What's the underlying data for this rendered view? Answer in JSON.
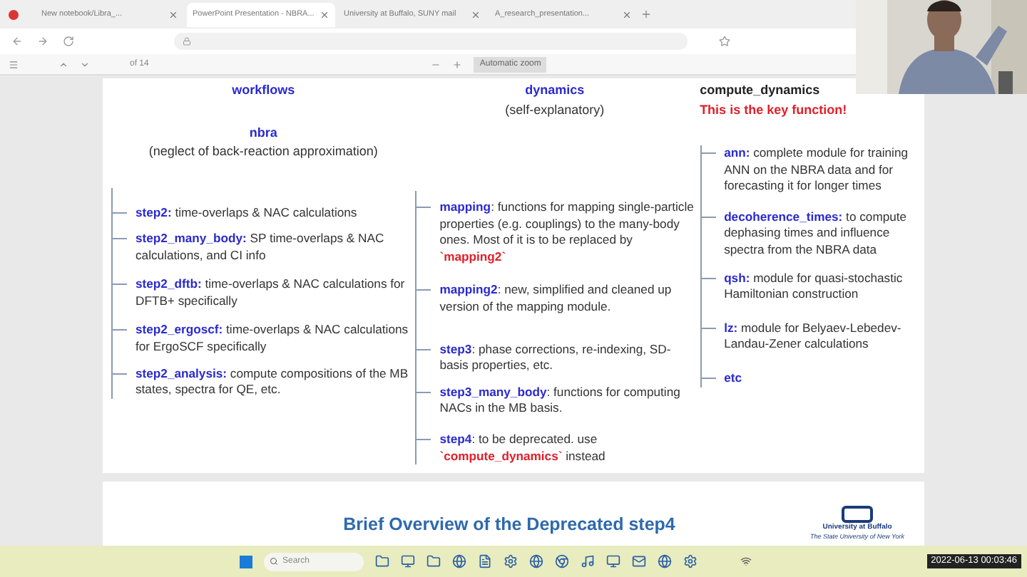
{
  "browser": {
    "tabs": [
      {
        "label": "New notebook/Libra_...",
        "selected": false
      },
      {
        "label": "PowerPoint Presentation - NBRA...",
        "selected": true
      },
      {
        "label": "University at Buffalo, SUNY mail",
        "selected": false
      },
      {
        "label": "A_research_presentation...",
        "selected": false
      }
    ],
    "page_counter": "of 14",
    "zoom": "Automatic zoom"
  },
  "slide": {
    "columns": [
      {
        "header": "workflows",
        "subheader": "nbra",
        "note": "(neglect of back-reaction approximation)",
        "items": [
          {
            "name": "step2:",
            "parts": [
              {
                "kind": "plain",
                "text": " time-overlaps & NAC calculations"
              }
            ]
          },
          {
            "name": "step2_many_body:",
            "parts": [
              {
                "kind": "plain",
                "text": " SP time-overlaps & NAC calculations, and CI info"
              }
            ]
          },
          {
            "name": "step2_dftb:",
            "parts": [
              {
                "kind": "plain",
                "text": " time-overlaps & NAC calculations for DFTB+ specifically"
              }
            ]
          },
          {
            "name": "step2_ergoscf:",
            "parts": [
              {
                "kind": "plain",
                "text": " time-overlaps & NAC calculations for ErgoSCF specifically"
              }
            ]
          },
          {
            "name": "step2_analysis:",
            "parts": [
              {
                "kind": "plain",
                "text": " compute compositions of the MB states, spectra for QE, etc."
              }
            ]
          }
        ]
      },
      {
        "header": "dynamics",
        "note": "(self-explanatory)",
        "items": [
          {
            "name": "mapping",
            "parts": [
              {
                "kind": "plain",
                "text": ": functions for mapping single-particle properties (e.g. couplings) to the many-body ones. Most of it is to be replaced by "
              },
              {
                "kind": "code",
                "text": "`mapping2`"
              }
            ]
          },
          {
            "name": "mapping2",
            "parts": [
              {
                "kind": "plain",
                "text": ": new, simplified and cleaned up version of the mapping module."
              }
            ]
          },
          {
            "name": "step3",
            "parts": [
              {
                "kind": "plain",
                "text": ": phase corrections, re-indexing, SD-basis properties, etc."
              }
            ]
          },
          {
            "name": "step3_many_body",
            "parts": [
              {
                "kind": "plain",
                "text": ": functions for computing NACs in the MB basis."
              }
            ]
          },
          {
            "name": "step4",
            "parts": [
              {
                "kind": "plain",
                "text": ": to be deprecated. use "
              },
              {
                "kind": "code",
                "text": "`compute_dynamics`"
              },
              {
                "kind": "plain",
                "text": " instead"
              }
            ]
          }
        ]
      },
      {
        "header": "compute_dynamics",
        "alert": "This is the key function!",
        "items": [
          {
            "name": "ann:",
            "parts": [
              {
                "kind": "plain",
                "text": " complete module for training ANN on the NBRA data and for forecasting it for longer times"
              }
            ]
          },
          {
            "name": "decoherence_times:",
            "parts": [
              {
                "kind": "plain",
                "text": " to compute dephasing times and influence spectra from the NBRA data"
              }
            ]
          },
          {
            "name": "qsh:",
            "parts": [
              {
                "kind": "plain",
                "text": " module for quasi-stochastic Hamiltonian construction"
              }
            ]
          },
          {
            "name": "lz:",
            "parts": [
              {
                "kind": "plain",
                "text": " module for Belyaev-Lebedev-Landau-Zener calculations"
              }
            ]
          },
          {
            "name": "etc"
          }
        ]
      }
    ]
  },
  "next_slide": {
    "title": "Brief Overview of the Deprecated step4",
    "logo_text": "University at Buffalo",
    "logo_subtext": "The State University of New York"
  },
  "taskbar": {
    "search": "Search",
    "clock": "2022-06-13 00:03:46"
  }
}
